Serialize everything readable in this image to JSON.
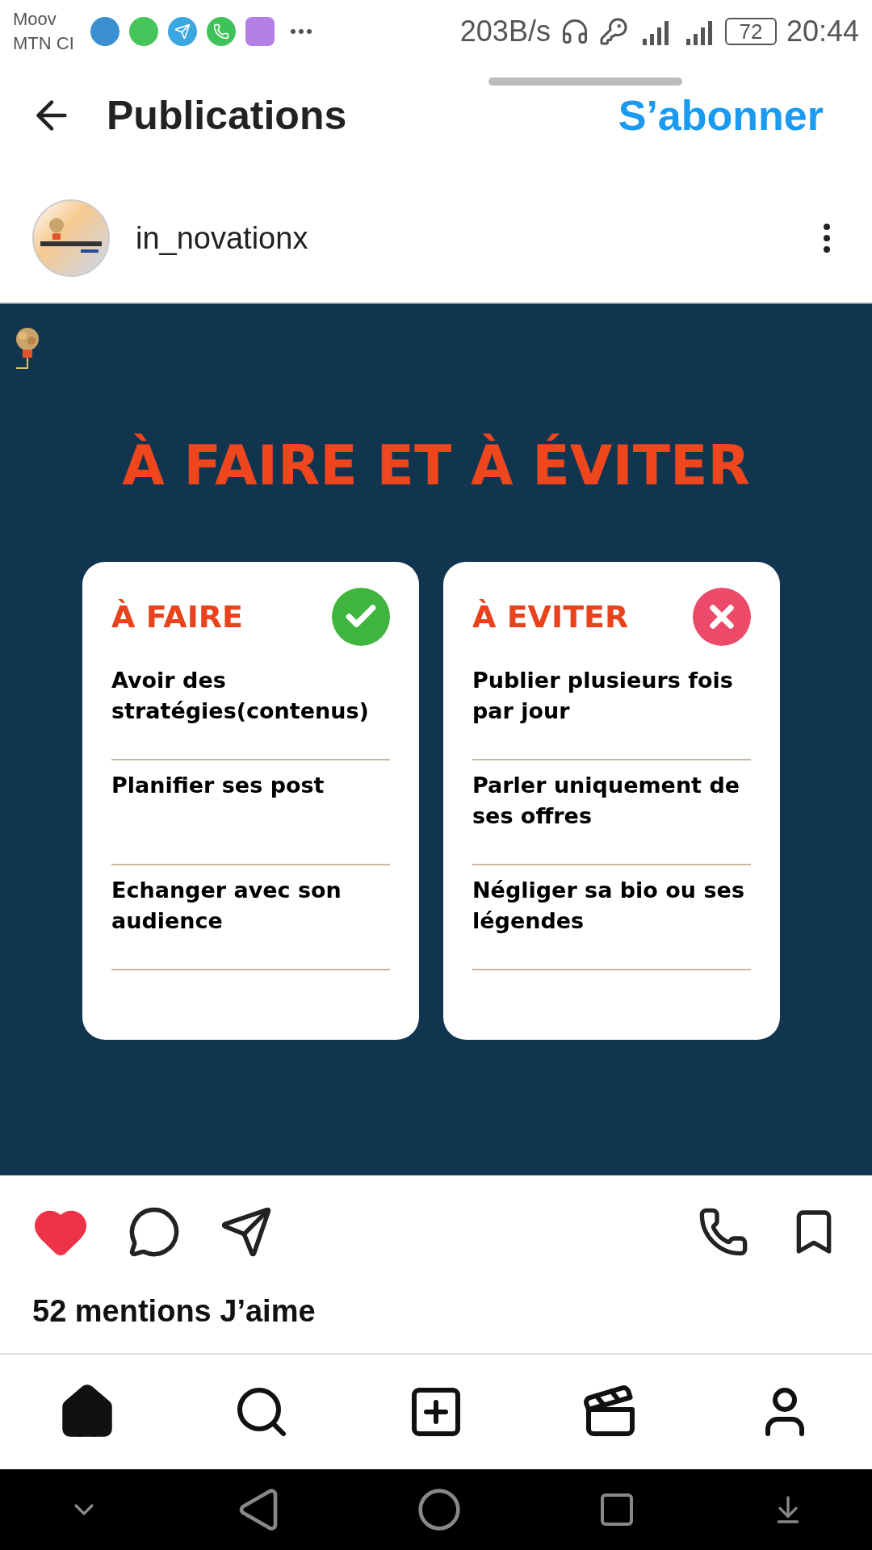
{
  "status_bar": {
    "carriers": [
      "Moov",
      "MTN CI"
    ],
    "speed": "203B/s",
    "battery": "72",
    "time": "20:44"
  },
  "header": {
    "title": "Publications",
    "follow": "S’abonner"
  },
  "profile": {
    "username": "in_novationx"
  },
  "post": {
    "title": "À FAIRE ET À ÉVITER",
    "cards": [
      {
        "kind": "do",
        "heading": "À FAIRE",
        "items": [
          "Avoir des stratégies(contenus)",
          "Planifier ses post",
          "Echanger avec son audience"
        ]
      },
      {
        "kind": "dont",
        "heading": "À EVITER",
        "items": [
          "Publier plusieurs fois par jour",
          "Parler uniquement de ses offres",
          "Négliger sa bio ou ses légendes"
        ]
      }
    ]
  },
  "actions": {
    "liked": true,
    "likes": "52 mentions J’aime"
  },
  "bottom_nav": [
    {
      "kind": "home",
      "selected": true
    },
    {
      "kind": "search",
      "selected": false
    },
    {
      "kind": "add",
      "selected": false
    },
    {
      "kind": "reels",
      "selected": false
    },
    {
      "kind": "profile",
      "selected": false
    }
  ]
}
